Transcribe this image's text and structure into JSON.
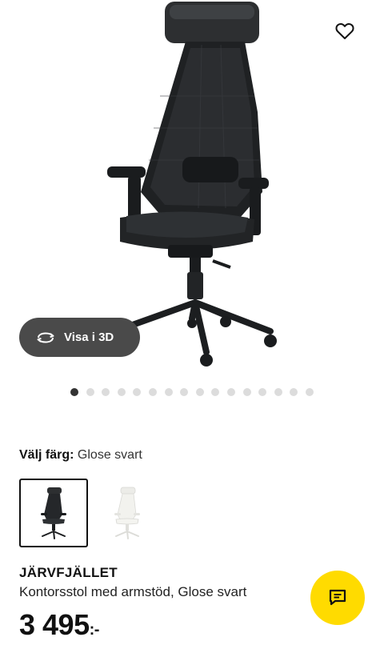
{
  "product": {
    "name": "JÄRVFJÄLLET",
    "description": "Kontorsstol med armstöd, Glose svart",
    "price_main": "3 495",
    "price_suffix": ":-"
  },
  "view3d": {
    "label": "Visa i 3D"
  },
  "color": {
    "label": "Välj färg:",
    "value": "Glose svart"
  },
  "carousel": {
    "count": 16,
    "active": 0
  },
  "icons": {
    "favorite": "heart-outline-icon",
    "rotate": "rotate-3d-icon",
    "chat": "chat-bubble-icon"
  },
  "colors": {
    "accent": "#ffdb00",
    "dark_button": "#4a4a4a"
  }
}
